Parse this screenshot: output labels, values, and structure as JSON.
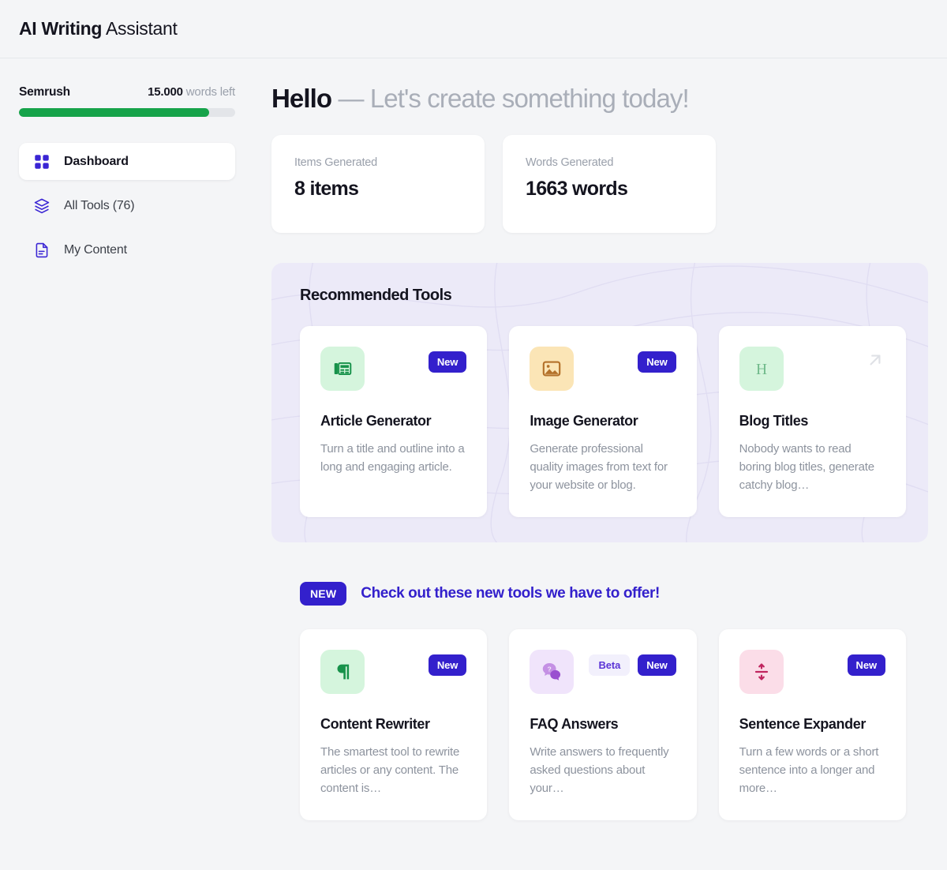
{
  "header": {
    "title_bold": "AI Writing",
    "title_normal": " Assistant"
  },
  "sidebar": {
    "quota": {
      "brand": "Semrush",
      "amount": "15.000",
      "suffix": " words left",
      "fill_percent": 88,
      "fill_color": "#16a34a",
      "track_color": "#e3e5e9"
    },
    "items": [
      {
        "label": "Dashboard",
        "icon": "grid-icon",
        "active": true
      },
      {
        "label": "All Tools (76)",
        "icon": "layers-icon",
        "active": false
      },
      {
        "label": "My Content",
        "icon": "document-icon",
        "active": false
      }
    ]
  },
  "main": {
    "greeting_name": "Hello",
    "greeting_message": " — Let's create something today!",
    "stats": [
      {
        "label": "Items Generated",
        "value": "8 items"
      },
      {
        "label": "Words Generated",
        "value": "1663 words"
      }
    ],
    "recommended": {
      "title": "Recommended Tools",
      "background": "#eceaf8",
      "cards": [
        {
          "name": "Article Generator",
          "description": "Turn a title and outline into a long and engaging article.",
          "icon": "newspaper-icon",
          "icon_bg": "#d5f5dd",
          "icon_color": "#17924a",
          "badge_new": "New",
          "badge_beta": null,
          "arrow": false
        },
        {
          "name": "Image Generator",
          "description": "Generate professional quality images from text for your website or blog.",
          "icon": "image-icon",
          "icon_bg": "#fbe5b6",
          "icon_color": "#b4712a",
          "badge_new": "New",
          "badge_beta": null,
          "arrow": false
        },
        {
          "name": "Blog Titles",
          "description": "Nobody wants to read boring blog titles, generate catchy blog…",
          "icon": "heading-icon",
          "icon_bg": "#d5f5dd",
          "icon_color": "#6fb98a",
          "badge_new": null,
          "badge_beta": null,
          "arrow": true
        }
      ]
    },
    "new_tools_banner": {
      "tag": "NEW",
      "text": "Check out these new tools we have to offer!",
      "accent_color": "#3320cc"
    },
    "new_tools": [
      {
        "name": "Content Rewriter",
        "description": "The smartest tool to rewrite articles or any content. The content is…",
        "icon": "pilcrow-icon",
        "icon_bg": "#d5f5dd",
        "icon_color": "#17924a",
        "badge_new": "New",
        "badge_beta": null,
        "arrow": false
      },
      {
        "name": "FAQ Answers",
        "description": "Write answers to frequently asked questions about your…",
        "icon": "chat-question-icon",
        "icon_bg": "#f0e4fb",
        "icon_color": "#9a4fd0",
        "badge_new": "New",
        "badge_beta": "Beta",
        "arrow": false
      },
      {
        "name": "Sentence Expander",
        "description": "Turn a few words or a short sentence into a longer and more…",
        "icon": "expand-vertical-icon",
        "icon_bg": "#fbdde8",
        "icon_color": "#c0255f",
        "badge_new": "New",
        "badge_beta": null,
        "arrow": false
      }
    ]
  }
}
